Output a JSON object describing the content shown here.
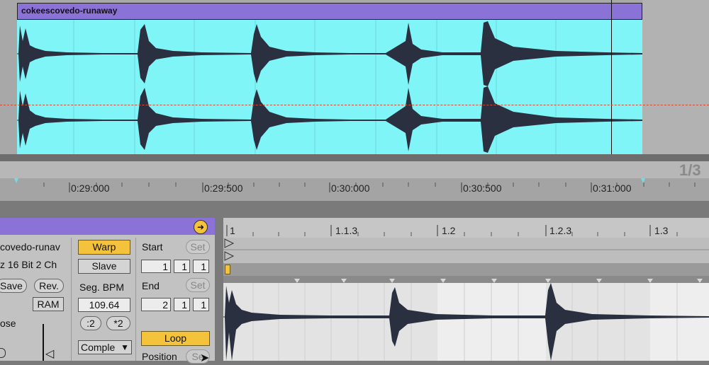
{
  "arrangement": {
    "clip_name": "cokeescovedo-runaway",
    "bar_fraction": "1/3",
    "time_labels": [
      "0:29:000",
      "0:29:500",
      "0:30:000",
      "0:30:500",
      "0:31:000"
    ]
  },
  "clip_panel": {
    "file_name": "covedo-runav",
    "file_info": "z 16 Bit 2 Ch",
    "save_label": "Save",
    "rev_label": "Rev.",
    "ram_label": "RAM",
    "transpose_label": "ose",
    "warp_label": "Warp",
    "slave_label": "Slave",
    "seg_bpm_label": "Seg. BPM",
    "seg_bpm_value": "109.64",
    "half_label": ":2",
    "double_label": "*2",
    "warp_mode": "Comple",
    "start_label": "Start",
    "start_set": "Set",
    "start_values": [
      "1",
      "1",
      "1"
    ],
    "end_label": "End",
    "end_set": "Set",
    "end_values": [
      "2",
      "1",
      "1"
    ],
    "loop_label": "Loop",
    "position_label": "Position",
    "position_set": "Se"
  },
  "sample_editor": {
    "marker_labels": [
      "1",
      "1.1.3",
      "1.2",
      "1.2.3",
      "1.3"
    ]
  },
  "colors": {
    "clip_purple": "#8a72d6",
    "waveform_cyan": "#7ff5f8",
    "button_yellow": "#f5c33b",
    "waveform_dark": "#2b3040"
  }
}
